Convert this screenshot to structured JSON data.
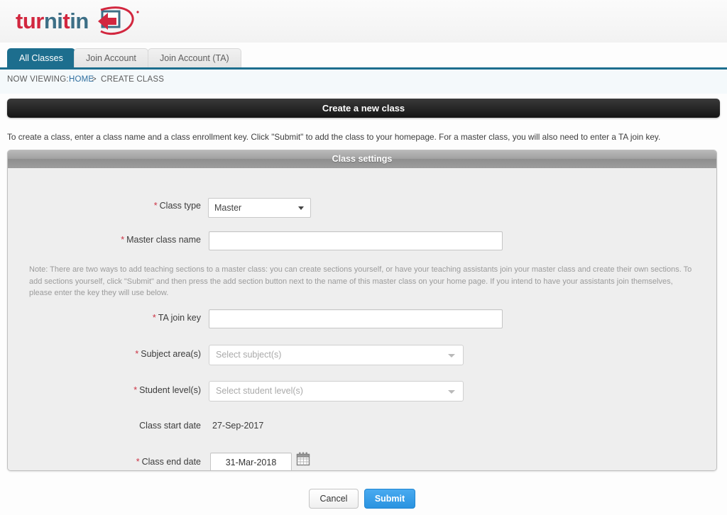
{
  "brand": {
    "name_parts": [
      "tur",
      "ni",
      "t",
      "in"
    ],
    "accent_red": "#d2273f",
    "accent_blue": "#3d6f86",
    "logo_mark": "turnitin-swoosh-icon"
  },
  "tabs": [
    {
      "label": "All Classes",
      "active": true
    },
    {
      "label": "Join Account",
      "active": false
    },
    {
      "label": "Join Account (TA)",
      "active": false
    }
  ],
  "breadcrumb": {
    "prefix": "NOW VIEWING:",
    "home": "HOME",
    "separator": ">",
    "current": "CREATE CLASS"
  },
  "page_title": "Create a new class",
  "intro_text": "To create a class, enter a class name and a class enrollment key. Click \"Submit\" to add the class to your homepage. For a master class, you will also need to enter a TA join key.",
  "panel": {
    "header": "Class settings",
    "note": "Note: There are two ways to add teaching sections to a master class: you can create sections yourself, or have your teaching assistants join your master class and create their own sections. To add sections yourself, click \"Submit\" and then press the add section button next to the name of this master class on your home page. If you intend to have your assistants join themselves, please enter the key they will use below.",
    "fields": {
      "class_type": {
        "label": "Class type",
        "required": true,
        "value": "Master",
        "control": "select"
      },
      "master_class_name": {
        "label": "Master class name",
        "required": true,
        "value": "",
        "control": "text"
      },
      "ta_join_key": {
        "label": "TA join key",
        "required": true,
        "value": "",
        "control": "text"
      },
      "subject_areas": {
        "label": "Subject area(s)",
        "required": true,
        "placeholder": "Select subject(s)",
        "value": "",
        "control": "multiselect"
      },
      "student_levels": {
        "label": "Student level(s)",
        "required": true,
        "placeholder": "Select student level(s)",
        "value": "",
        "control": "multiselect"
      },
      "class_start_date": {
        "label": "Class start date",
        "required": false,
        "value": "27-Sep-2017",
        "control": "readonly"
      },
      "class_end_date": {
        "label": "Class end date",
        "required": true,
        "value": "31-Mar-2018",
        "control": "date",
        "picker_icon": "calendar-icon"
      }
    },
    "required_marker": "*"
  },
  "footer": {
    "cancel_label": "Cancel",
    "submit_label": "Submit",
    "submit_color": "#2a93e0"
  }
}
